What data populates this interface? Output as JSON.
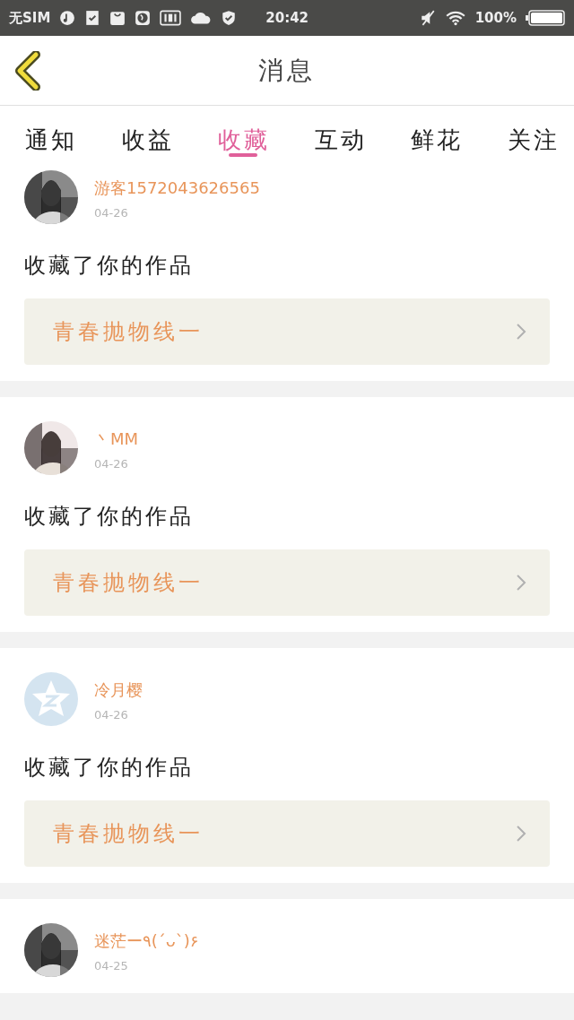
{
  "status_bar": {
    "carrier": "无SIM",
    "time": "20:42",
    "battery": "100%"
  },
  "header": {
    "title": "消息"
  },
  "tabs": [
    {
      "label": "通知",
      "selected": false
    },
    {
      "label": "收益",
      "selected": false
    },
    {
      "label": "收藏",
      "selected": true
    },
    {
      "label": "互动",
      "selected": false
    },
    {
      "label": "鲜花",
      "selected": false
    },
    {
      "label": "关注",
      "selected": false
    }
  ],
  "messages": [
    {
      "name": "游客1572043626565",
      "date": "04-26",
      "text": "收藏了你的作品",
      "work": "青春抛物线一"
    },
    {
      "name": "丶MM",
      "date": "04-26",
      "text": "收藏了你的作品",
      "work": "青春抛物线一"
    },
    {
      "avatar": {
        "kind": "default"
      },
      "name": "冷月樱",
      "date": "04-26",
      "text": "收藏了你的作品",
      "work": "青春抛物线一"
    },
    {
      "name": "迷茫ー٩(ˊᴗˋ)۶",
      "date": "04-25"
    }
  ]
}
